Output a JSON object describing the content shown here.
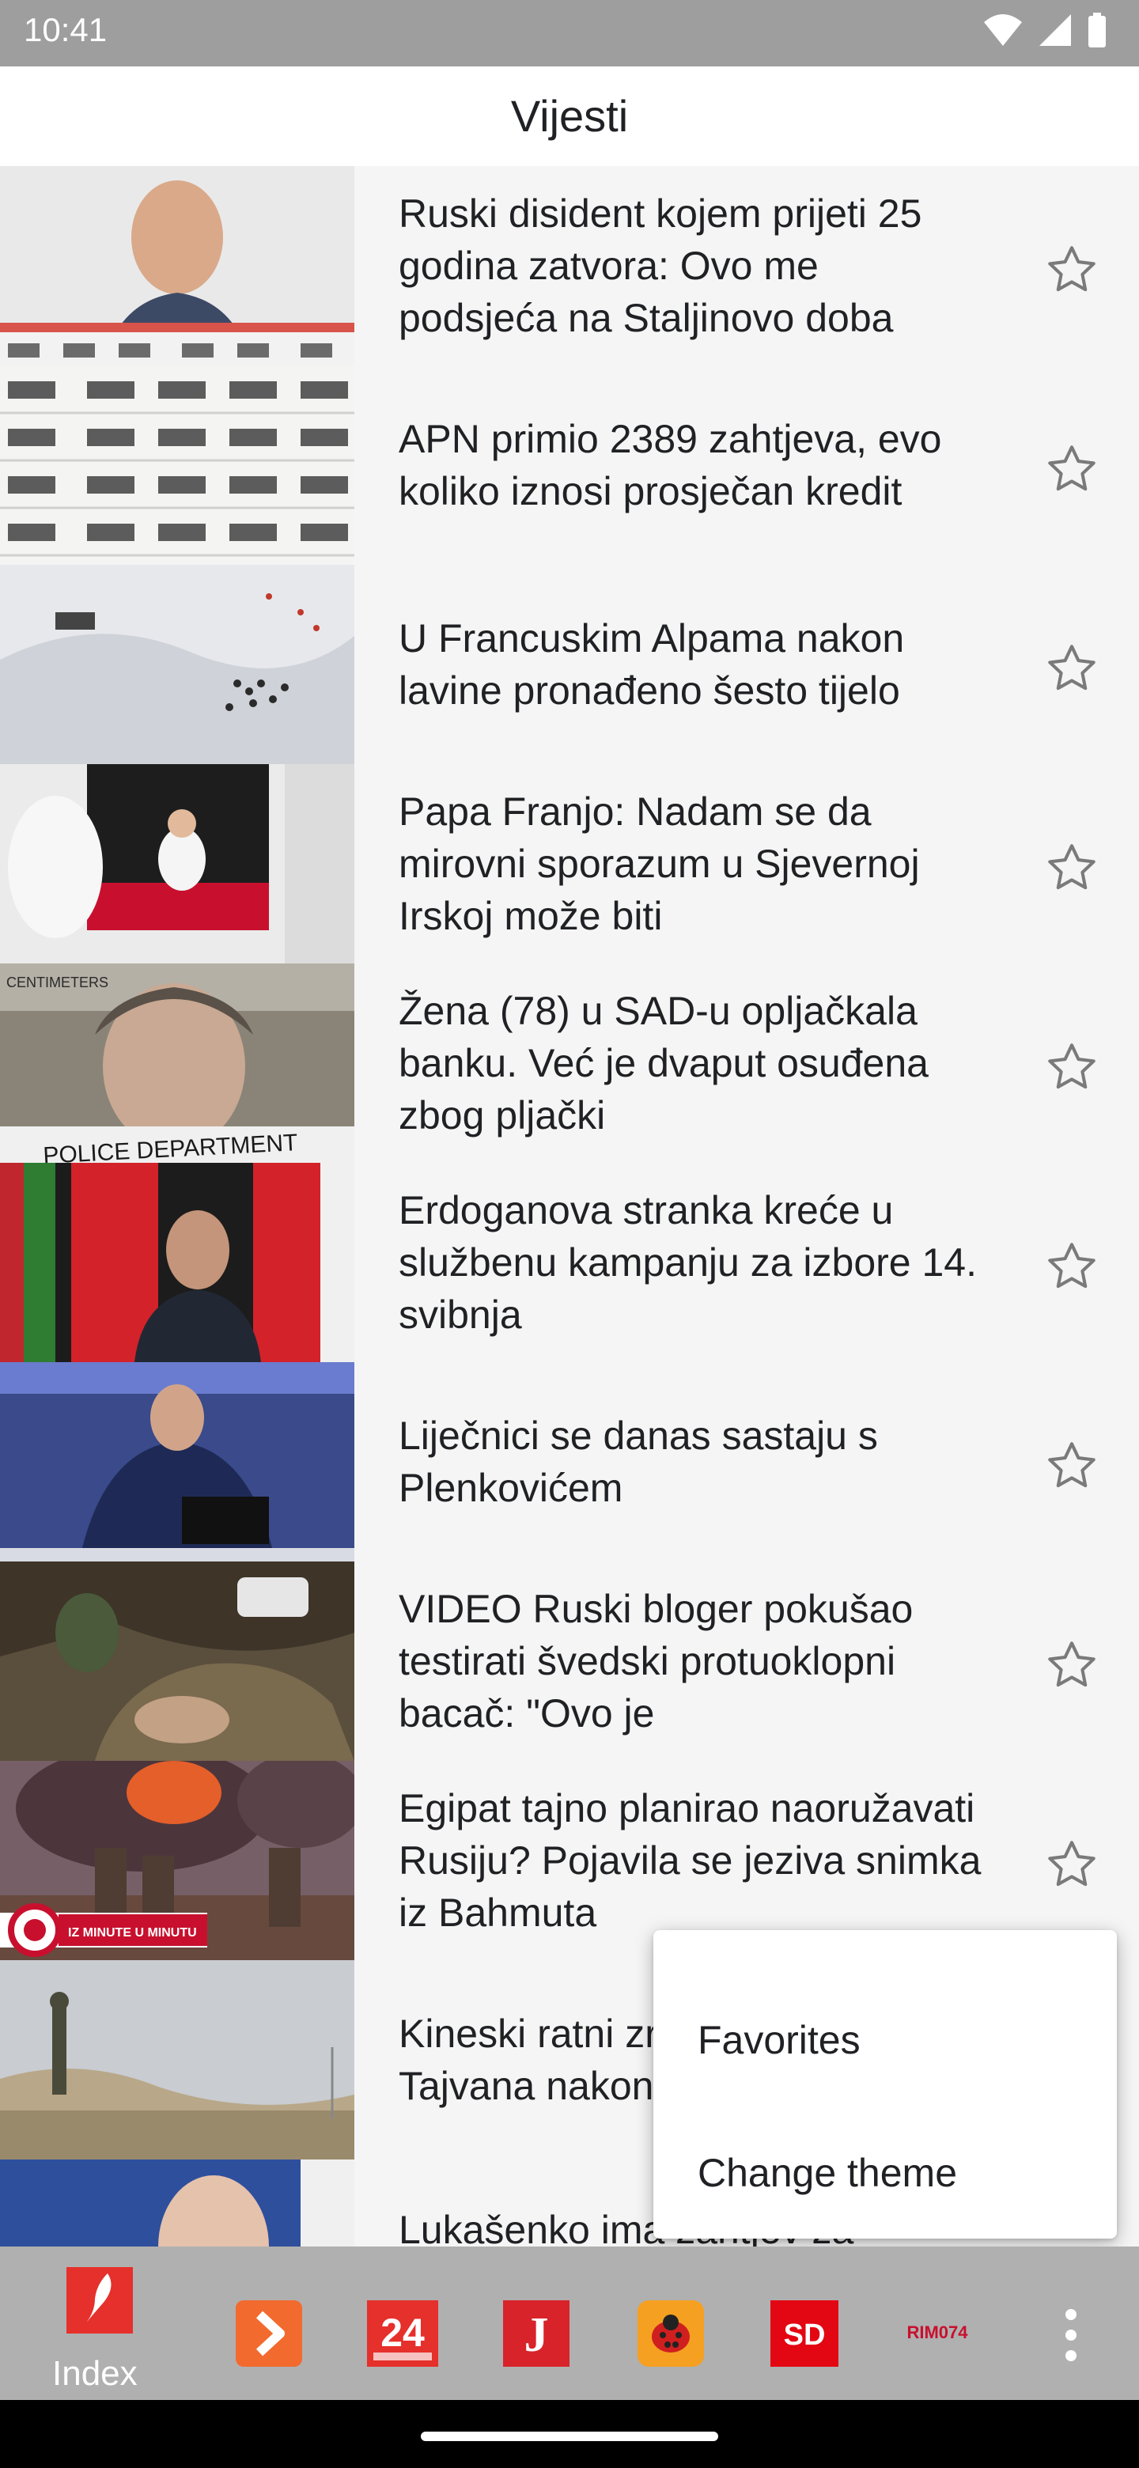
{
  "status_bar": {
    "time": "10:41"
  },
  "app_bar": {
    "title": "Vijesti"
  },
  "news": [
    {
      "headline": "Ruski disident kojem prijeti 25 godina zatvora: Ovo me podsjeća na Staljinovo doba"
    },
    {
      "headline": "APN primio 2389 zahtjeva, evo koliko iznosi prosječan kredit"
    },
    {
      "headline": "U Francuskim Alpama nakon lavine pronađeno šesto tijelo"
    },
    {
      "headline": "Papa Franjo: Nadam se da mirovni sporazum u Sjevernoj Irskoj može biti"
    },
    {
      "headline": "Žena (78) u SAD-u opljačkala banku. Već je dvaput osuđena zbog pljački"
    },
    {
      "headline": "Erdoganova stranka kreće u službenu kampanju za izbore 14. svibnja"
    },
    {
      "headline": "Liječnici se danas sastaju s Plenkovićem"
    },
    {
      "headline": "VIDEO Ruski bloger pokušao testirati švedski protuoklopni bacač: \"Ovo je"
    },
    {
      "headline": "Egipat tajno planirao naoružavati Rusiju? Pojavila se jeziva snimka iz Bahmuta",
      "thumb_overlay": "IZ MINUTE U MINUTU"
    },
    {
      "headline": "Kineski ratni zrakoplovi oko Tajvana nakon"
    },
    {
      "headline": "Lukašenko ima zahtjev za"
    }
  ],
  "thumb_text": {
    "police": "POLICE DEPARTMENT",
    "centimeters": "CENTIMETERS"
  },
  "menu": {
    "favorites": "Favorites",
    "change_theme": "Change theme"
  },
  "bottom_nav": {
    "active_label": "Index",
    "tabs": [
      {
        "name": "index",
        "label": "Index"
      },
      {
        "name": "vecernji",
        "glyph": "›"
      },
      {
        "name": "24sata",
        "glyph": "24"
      },
      {
        "name": "jutarnji",
        "glyph": "J"
      },
      {
        "name": "ladybug",
        "glyph": ""
      },
      {
        "name": "slobodna-dalmacija",
        "glyph": "SD"
      },
      {
        "name": "rijeka",
        "glyph": "RIM074"
      }
    ]
  },
  "colors": {
    "status_bar": "#9e9e9e",
    "nav": "#b0b0b0",
    "brand_red": "#e5302b",
    "orange": "#f26a2e",
    "star": "#7a7a7a"
  }
}
